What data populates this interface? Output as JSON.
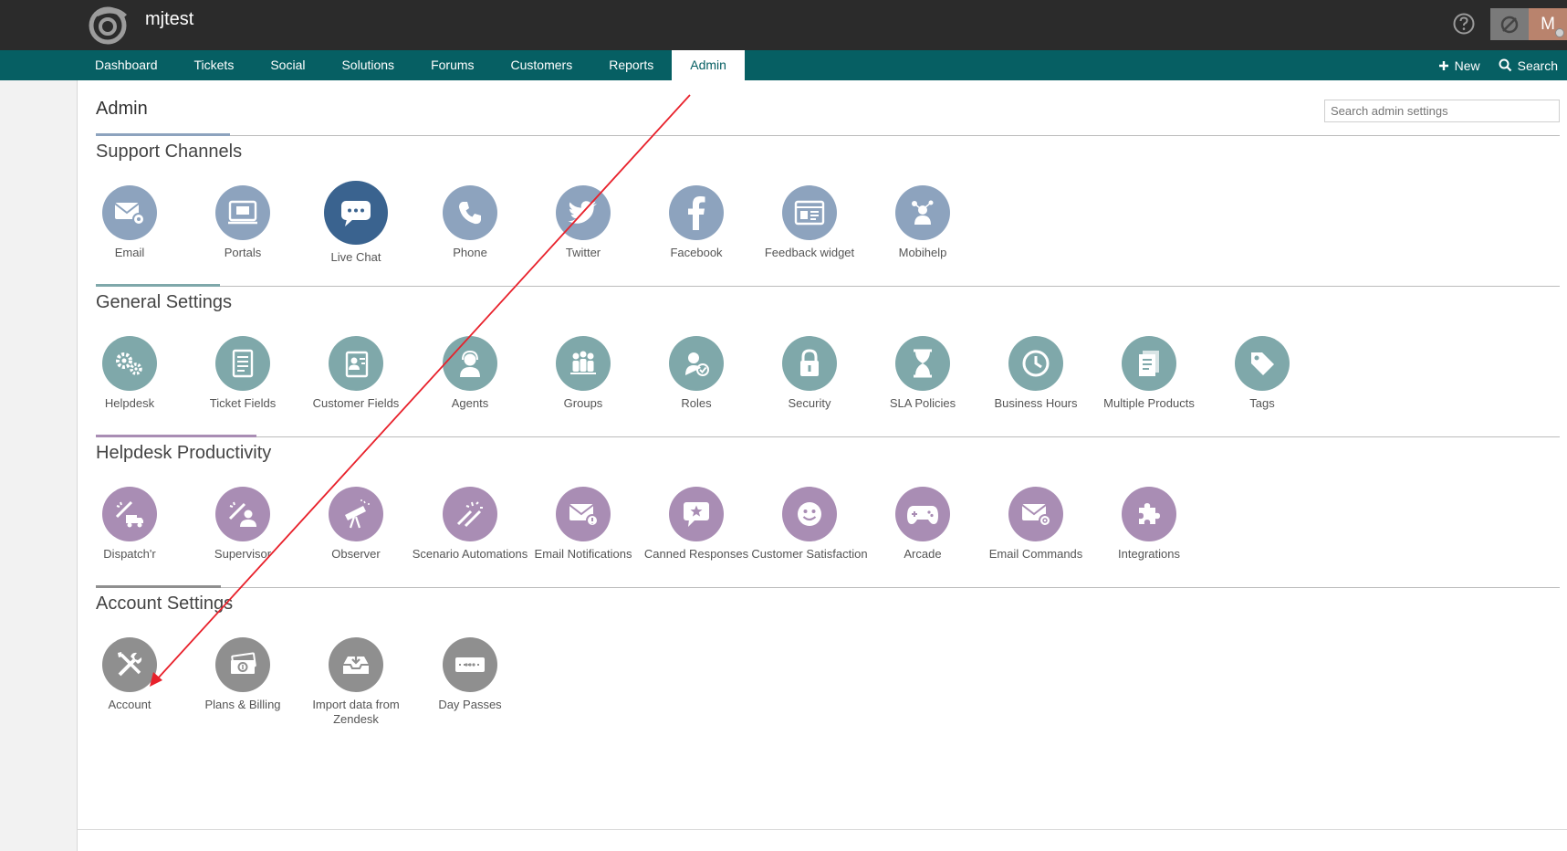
{
  "header": {
    "app_title": "mjtest",
    "avatar_initial": "M"
  },
  "nav": {
    "items": [
      "Dashboard",
      "Tickets",
      "Social",
      "Solutions",
      "Forums",
      "Customers",
      "Reports",
      "Admin"
    ],
    "active": "Admin",
    "new_label": "New",
    "search_label": "Search"
  },
  "page": {
    "title": "Admin",
    "search_placeholder": "Search admin settings"
  },
  "sections": {
    "support_channels": {
      "title": "Support Channels",
      "accent_color": "#8da3be",
      "items": [
        "Email",
        "Portals",
        "Live Chat",
        "Phone",
        "Twitter",
        "Facebook",
        "Feedback widget",
        "Mobihelp"
      ]
    },
    "general_settings": {
      "title": "General Settings",
      "accent_color": "#7fa8aa",
      "items": [
        "Helpdesk",
        "Ticket Fields",
        "Customer Fields",
        "Agents",
        "Groups",
        "Roles",
        "Security",
        "SLA Policies",
        "Business Hours",
        "Multiple Products",
        "Tags"
      ]
    },
    "helpdesk_productivity": {
      "title": "Helpdesk Productivity",
      "accent_color": "#a98db4",
      "items": [
        "Dispatch'r",
        "Supervisor",
        "Observer",
        "Scenario Automations",
        "Email Notifications",
        "Canned Responses",
        "Customer Satisfaction",
        "Arcade",
        "Email Commands",
        "Integrations"
      ]
    },
    "account_settings": {
      "title": "Account Settings",
      "accent_color": "#8f8f8f",
      "items": [
        "Account",
        "Plans & Billing",
        "Import data from Zendesk",
        "Day Passes"
      ]
    }
  },
  "colors": {
    "topbar": "#2b2b2b",
    "navbar": "#065f63",
    "annotation_arrow": "#e8212b"
  },
  "icons": {
    "logo": "freshdesk-logo-icon",
    "help": "help-circle-icon",
    "new": "plus-icon",
    "search": "search-icon"
  }
}
